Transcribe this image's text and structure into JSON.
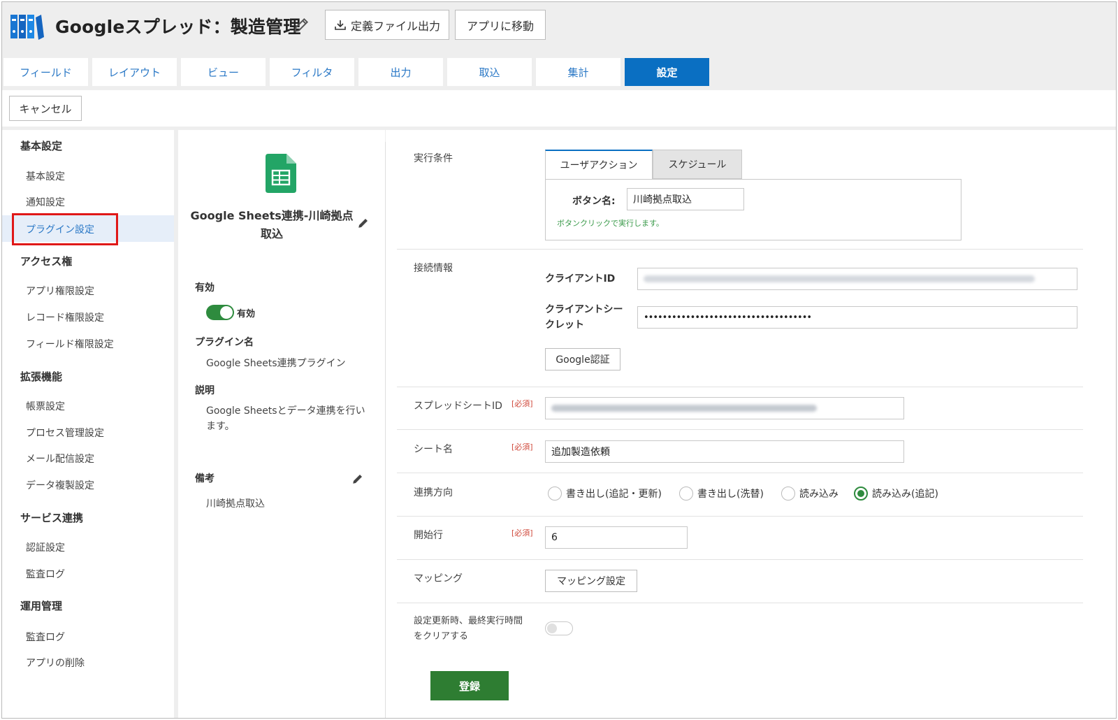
{
  "header": {
    "title": "Googleスプレッド：製造管理",
    "export_button": "定義ファイル出力",
    "goto_app_button": "アプリに移動"
  },
  "tabs": [
    {
      "label": "フィールド"
    },
    {
      "label": "レイアウト"
    },
    {
      "label": "ビュー"
    },
    {
      "label": "フィルタ"
    },
    {
      "label": "出力"
    },
    {
      "label": "取込"
    },
    {
      "label": "集計"
    },
    {
      "label": "設定"
    }
  ],
  "toolbar": {
    "cancel_label": "キャンセル"
  },
  "sidebar": {
    "sections": [
      {
        "title": "基本設定",
        "items": [
          "基本設定",
          "通知設定",
          "プラグイン設定"
        ]
      },
      {
        "title": "アクセス権",
        "items": [
          "アプリ権限設定",
          "レコード権限設定",
          "フィールド権限設定"
        ]
      },
      {
        "title": "拡張機能",
        "items": [
          "帳票設定",
          "プロセス管理設定",
          "メール配信設定",
          "データ複製設定"
        ]
      },
      {
        "title": "サービス連携",
        "items": [
          "認証設定",
          "監査ログ"
        ]
      },
      {
        "title": "運用管理",
        "items": [
          "監査ログ",
          "アプリの削除"
        ]
      }
    ],
    "active_item": "プラグイン設定"
  },
  "plugin": {
    "name_line1": "Google Sheets連携-川崎拠点",
    "name_line2": "取込",
    "enabled_label": "有効",
    "toggle_label": "有効",
    "plugin_name_label": "プラグイン名",
    "plugin_name": "Google Sheets連携プラグイン",
    "description_label": "説明",
    "description_line1": "Google Sheetsとデータ連携を行い",
    "description_line2": "ます。",
    "note_label": "備考",
    "note": "川崎拠点取込"
  },
  "settings": {
    "exec_condition_label": "実行条件",
    "exec_tabs": [
      "ユーザアクション",
      "スケジュール"
    ],
    "button_name_label": "ボタン名:",
    "button_name_value": "川崎拠点取込",
    "button_hint": "ボタンクリックで実行します。",
    "connection_label": "接続情報",
    "client_id_label": "クライアントID",
    "client_secret_label_1": "クライアントシー",
    "client_secret_label_2": "クレット",
    "client_secret_value": "••••••••••••••••••••••••••••••••••••",
    "google_auth_button": "Google認証",
    "spreadsheet_id_label": "スプレッドシートID",
    "required": "[必須]",
    "sheet_name_label": "シート名",
    "sheet_name_value": "追加製造依頼",
    "direction_label": "連携方向",
    "directions": [
      "書き出し(追記・更新)",
      "書き出し(洗替)",
      "読み込み",
      "読み込み(追記)"
    ],
    "selected_direction": "読み込み(追記)",
    "start_row_label": "開始行",
    "start_row_value": "6",
    "mapping_label": "マッピング",
    "mapping_button": "マッピング設定",
    "clear_label_1": "設定更新時、最終実行時間",
    "clear_label_2": "をクリアする",
    "submit_button": "登録"
  },
  "colors": {
    "accent": "#0a6fc2",
    "tab_text": "#2a78c6",
    "toggle_on": "#2e8b3e",
    "submit": "#2e7d32",
    "hint": "#3a9a4a",
    "highlight_box": "#e01818"
  }
}
